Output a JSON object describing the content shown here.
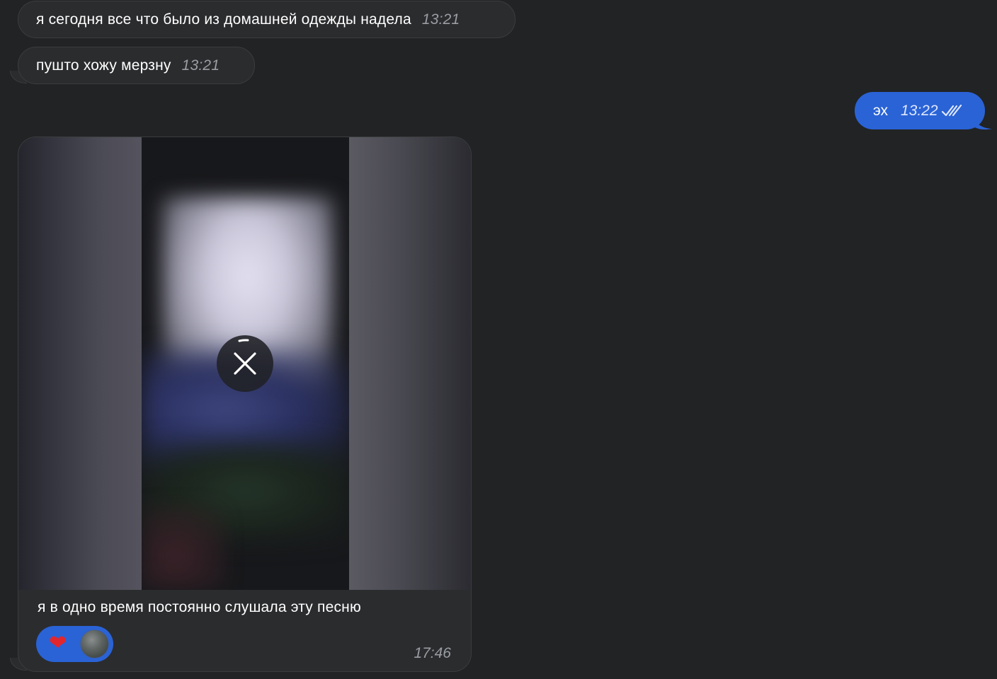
{
  "messages": {
    "m1": {
      "text": "я сегодня все что было из домашней одежды надела",
      "time": "13:21"
    },
    "m2": {
      "text": "пушто хожу мерзну",
      "time": "13:21"
    },
    "m3": {
      "text": "эх",
      "time": "13:22",
      "status_icon": "double-check-icon"
    },
    "m4": {
      "caption": "я в одно время постоянно слушала эту песню",
      "time": "17:46",
      "reaction_emoji": "❤️",
      "media_state_icon": "close-icon"
    }
  },
  "colors": {
    "background": "#212324",
    "incoming_bubble": "#2b2c2e",
    "outgoing_bubble": "#2a63d6",
    "time_text": "#9a9da3"
  }
}
